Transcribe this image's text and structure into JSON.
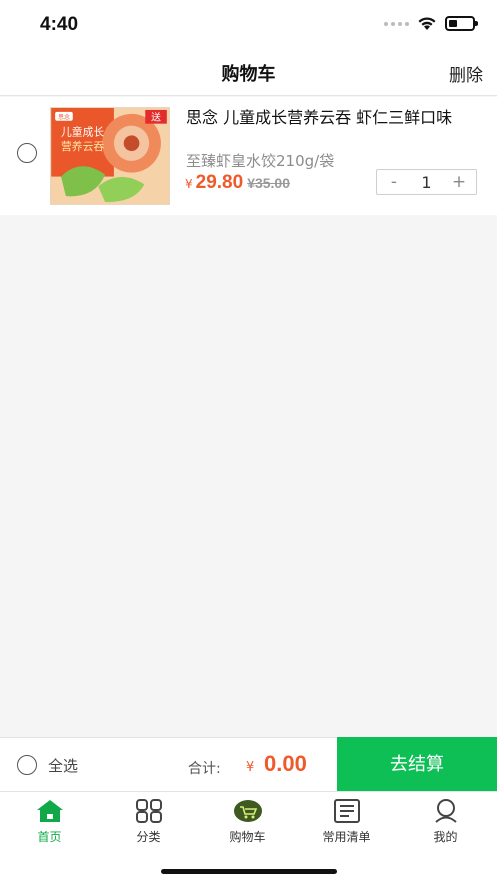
{
  "status": {
    "time": "4:40"
  },
  "nav": {
    "title": "购物车",
    "delete_label": "删除"
  },
  "cart_items": [
    {
      "title": "思念 儿童成长营养云吞 虾仁三鲜口味",
      "subtitle": "至臻虾皇水饺210g/袋",
      "price_symbol": "¥",
      "price": "29.80",
      "original_price": "¥35.00",
      "quantity": "1",
      "minus_label": "-",
      "plus_label": "+",
      "image_text": {
        "brand": "思念",
        "line1": "儿童成长",
        "line2": "营养云吞",
        "badge": "送"
      }
    }
  ],
  "checkout": {
    "select_all_label": "全选",
    "total_label": "合计:",
    "total_symbol": "¥",
    "total_value": "0.00",
    "button_label": "去结算"
  },
  "tabs": [
    {
      "label": "首页",
      "icon": "home-icon",
      "active": true
    },
    {
      "label": "分类",
      "icon": "grid-icon",
      "active": false
    },
    {
      "label": "购物车",
      "icon": "cart-icon",
      "active": false
    },
    {
      "label": "常用清单",
      "icon": "list-icon",
      "active": false
    },
    {
      "label": "我的",
      "icon": "user-icon",
      "active": false
    }
  ],
  "colors": {
    "accent": "#0dbf55",
    "price": "#f0592a",
    "tab_active": "#11a84a"
  }
}
